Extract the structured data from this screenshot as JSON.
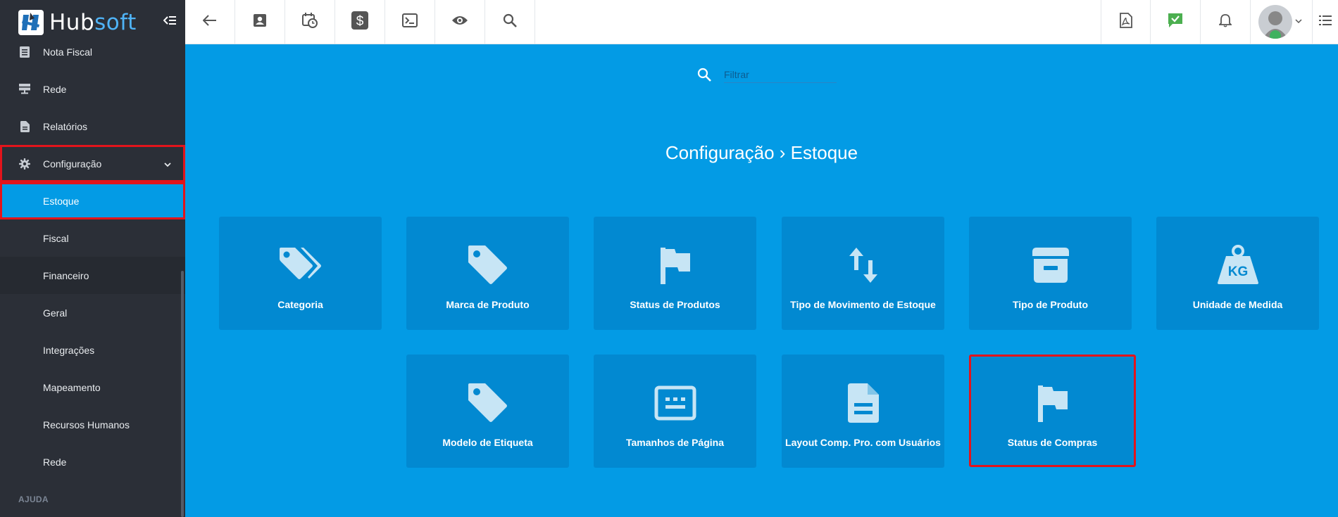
{
  "app": {
    "logo_main": "Hub",
    "logo_accent": "soft"
  },
  "sidebar": {
    "top_items": [
      {
        "label": "Nota Fiscal"
      },
      {
        "label": "Rede"
      },
      {
        "label": "Relatórios"
      }
    ],
    "config_item": {
      "label": "Configuração"
    },
    "sub_items": [
      {
        "label": "Estoque"
      },
      {
        "label": "Fiscal"
      },
      {
        "label": "Financeiro"
      },
      {
        "label": "Geral"
      },
      {
        "label": "Integrações"
      },
      {
        "label": "Mapeamento"
      },
      {
        "label": "Recursos Humanos"
      },
      {
        "label": "Rede"
      }
    ],
    "section_label": "AJUDA"
  },
  "topbar": {
    "left_icons": [
      "back-arrow-icon",
      "contact-card-icon",
      "calendar-clock-icon",
      "dollar-icon",
      "terminal-icon",
      "eye-icon",
      "search-icon"
    ],
    "right_icons": [
      "pdf-icon",
      "chat-check-icon",
      "bell-icon",
      "avatar",
      "list-icon"
    ]
  },
  "filter": {
    "placeholder": "Filtrar"
  },
  "page": {
    "title": "Configuração › Estoque"
  },
  "cards": [
    {
      "label": "Categoria",
      "icon": "tags-icon"
    },
    {
      "label": "Marca de Produto",
      "icon": "tag-icon"
    },
    {
      "label": "Status de Produtos",
      "icon": "flag-icon"
    },
    {
      "label": "Tipo de Movimento de Estoque",
      "icon": "swap-vertical-icon"
    },
    {
      "label": "Tipo de Produto",
      "icon": "box-icon"
    },
    {
      "label": "Unidade de Medida",
      "icon": "weight-kg-icon"
    },
    {
      "label": "Modelo de Etiqueta",
      "icon": "tag-icon"
    },
    {
      "label": "Tamanhos de Página",
      "icon": "page-size-icon"
    },
    {
      "label": "Layout Comp. Pro. com Usuários",
      "icon": "document-icon"
    },
    {
      "label": "Status de Compras",
      "icon": "flag-icon"
    }
  ],
  "kg_text": "KG",
  "colors": {
    "primary": "#039be5",
    "card": "#0289d1",
    "sidebar": "#2b2f37",
    "highlight": "#e3141b",
    "brand_accent": "#4fb3f6",
    "chat_green": "#4caf50"
  }
}
